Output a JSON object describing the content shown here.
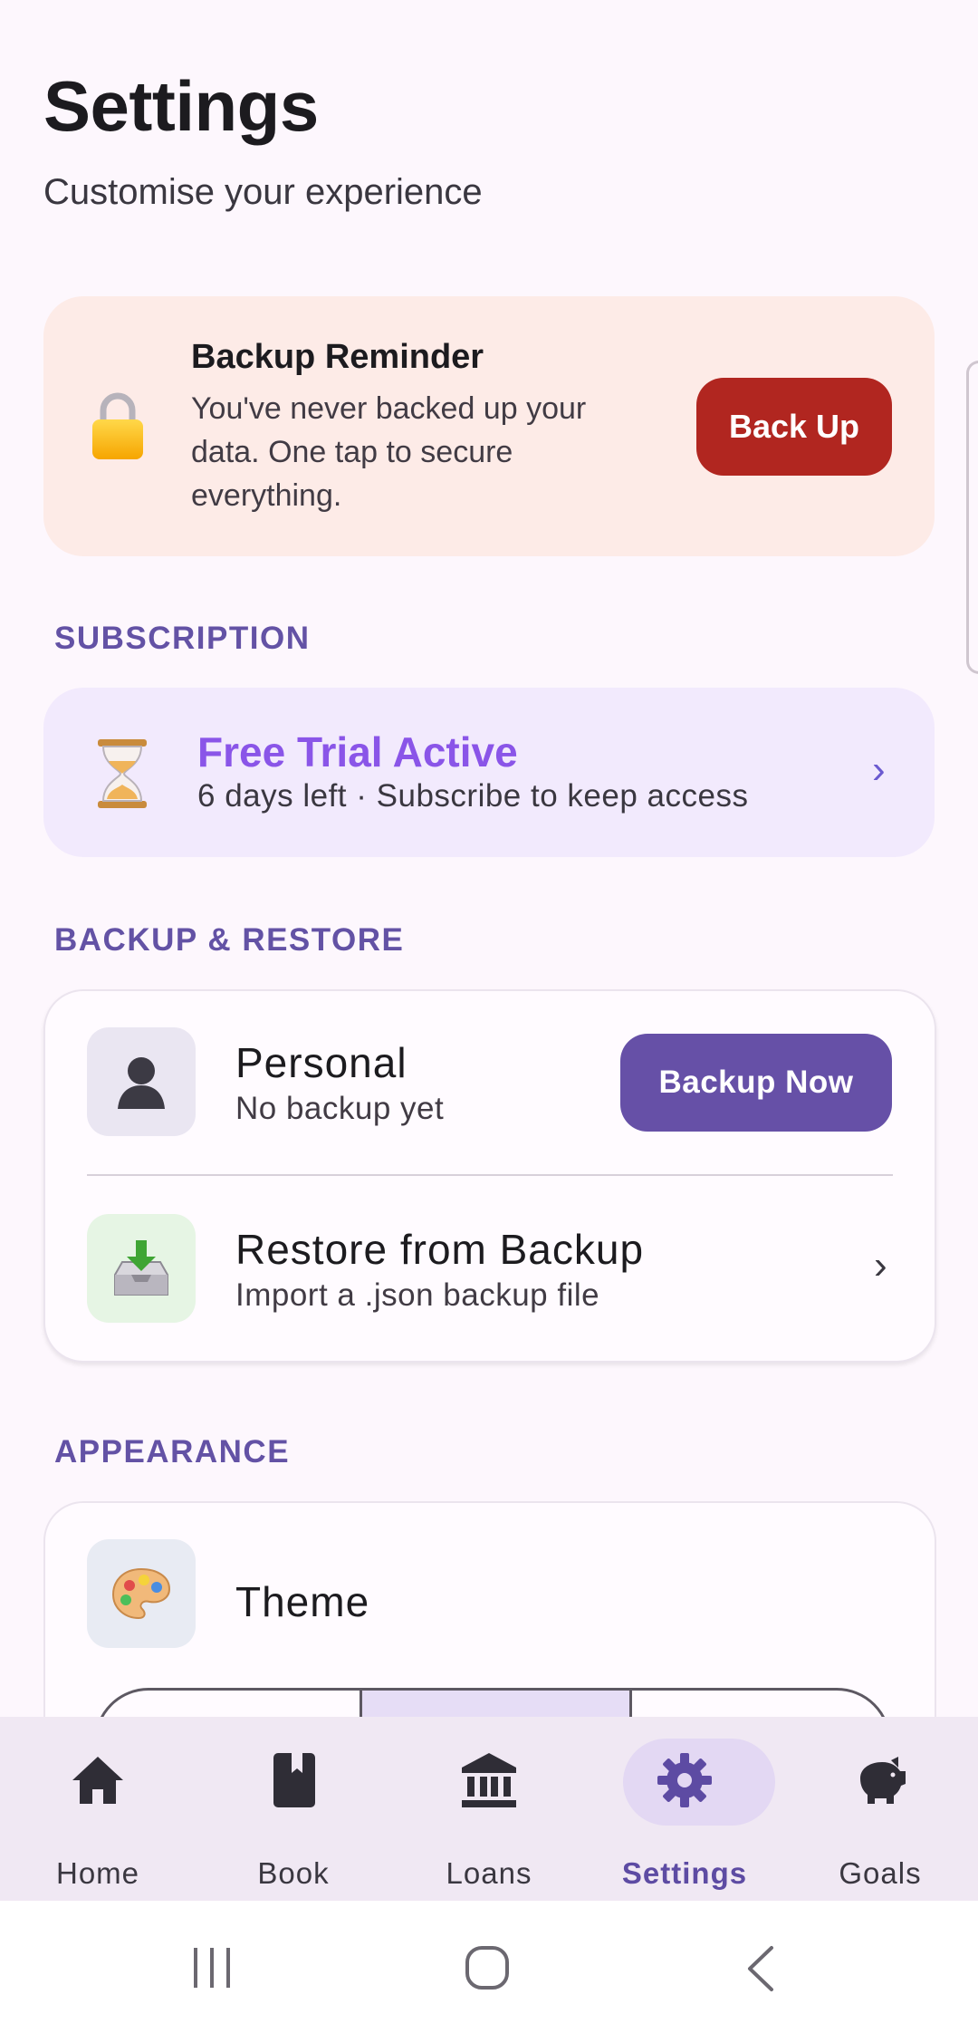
{
  "header": {
    "title": "Settings",
    "subtitle": "Customise your experience"
  },
  "backup_reminder": {
    "icon": "lock-icon",
    "title": "Backup Reminder",
    "body": "You've never backed up your data. One tap to secure everything.",
    "button_label": "Back Up"
  },
  "sections": {
    "subscription": "SUBSCRIPTION",
    "backup_restore": "BACKUP & RESTORE",
    "appearance": "APPEARANCE"
  },
  "subscription": {
    "icon": "hourglass-icon",
    "title": "Free Trial Active",
    "subtitle": "6 days left · Subscribe to keep access",
    "chevron": "›"
  },
  "backup_restore": {
    "personal": {
      "icon": "person-icon",
      "title": "Personal",
      "subtitle": "No backup yet",
      "button_label": "Backup Now"
    },
    "restore": {
      "icon": "inbox-download-icon",
      "title": "Restore from Backup",
      "subtitle": "Import a .json backup file",
      "chevron": "›"
    }
  },
  "appearance": {
    "theme": {
      "icon": "palette-icon",
      "title": "Theme"
    }
  },
  "bottom_nav": {
    "items": [
      {
        "label": "Home",
        "icon": "home-icon"
      },
      {
        "label": "Book",
        "icon": "book-icon"
      },
      {
        "label": "Loans",
        "icon": "bank-icon"
      },
      {
        "label": "Settings",
        "icon": "gear-icon",
        "active": true
      },
      {
        "label": "Goals",
        "icon": "piggy-bank-icon"
      }
    ]
  },
  "colors": {
    "background": "#fdf7fd",
    "accent": "#6650a7",
    "danger": "#b12620",
    "reminder_bg": "#fdebe7",
    "subscription_bg": "#f2eafd"
  }
}
